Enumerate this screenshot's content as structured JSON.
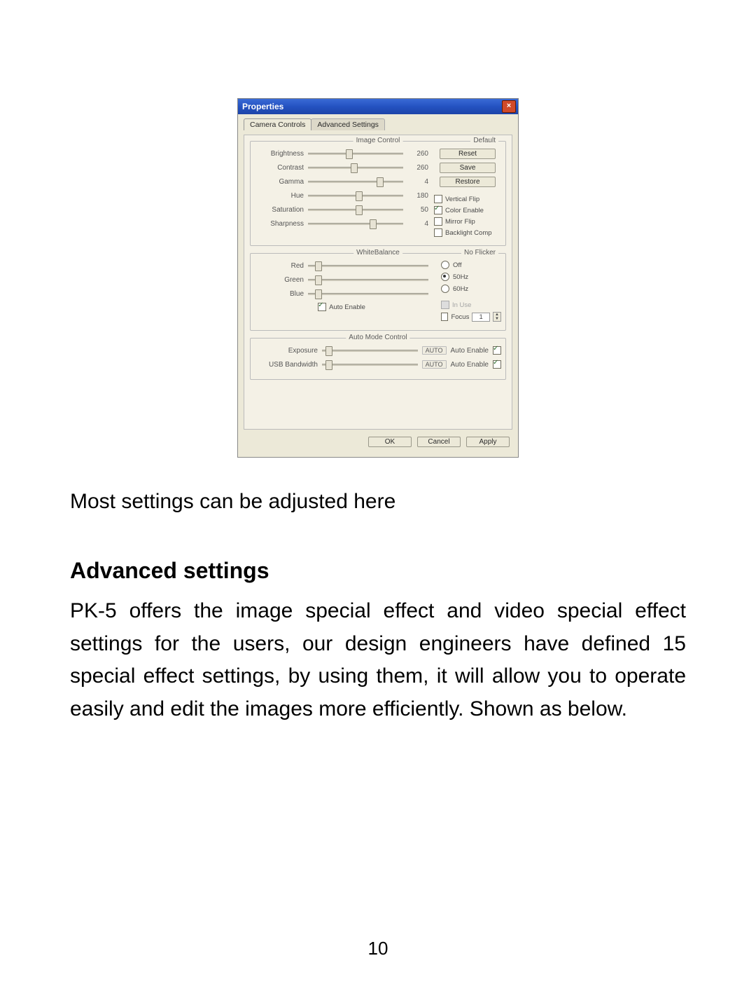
{
  "dialog": {
    "title": "Properties",
    "tabs": {
      "active": "Camera Controls",
      "inactive": "Advanced Settings"
    },
    "image_control": {
      "group_title": "Image Control",
      "sliders": [
        {
          "label": "Brightness",
          "value": "260",
          "pos": 40
        },
        {
          "label": "Contrast",
          "value": "260",
          "pos": 45
        },
        {
          "label": "Gamma",
          "value": "4",
          "pos": 72
        },
        {
          "label": "Hue",
          "value": "180",
          "pos": 50
        },
        {
          "label": "Saturation",
          "value": "50",
          "pos": 50
        },
        {
          "label": "Sharpness",
          "value": "4",
          "pos": 65
        }
      ],
      "default": {
        "group_title": "Default",
        "reset": "Reset",
        "save": "Save",
        "restore": "Restore"
      },
      "checks": {
        "vertical_flip": {
          "label": "Vertical Flip",
          "checked": false
        },
        "color_enable": {
          "label": "Color Enable",
          "checked": true
        },
        "mirror_flip": {
          "label": "Mirror Flip",
          "checked": false
        },
        "backlight": {
          "label": "Backlight Comp",
          "checked": false
        }
      }
    },
    "white_balance": {
      "group_title": "WhiteBalance",
      "sliders": [
        {
          "label": "Red",
          "pos": 6
        },
        {
          "label": "Green",
          "pos": 6
        },
        {
          "label": "Blue",
          "pos": 6
        }
      ],
      "auto_enable": {
        "label": "Auto Enable",
        "checked": true
      },
      "flicker": {
        "group_title": "No Flicker",
        "off": "Off",
        "hz50": "50Hz",
        "hz60": "60Hz",
        "selected": "hz50"
      },
      "focus": {
        "inuse_label": "In Use",
        "focus_label": "Focus",
        "focus_val": "1"
      }
    },
    "auto_mode": {
      "group_title": "Auto Mode Control",
      "rows": [
        {
          "label": "Exposure",
          "badge": "AUTO",
          "auto_label": "Auto Enable",
          "checked": true
        },
        {
          "label": "USB Bandwidth",
          "badge": "AUTO",
          "auto_label": "Auto Enable",
          "checked": true
        }
      ]
    },
    "buttons": {
      "ok": "OK",
      "cancel": "Cancel",
      "apply": "Apply"
    }
  },
  "body": {
    "caption": "Most settings can be adjusted here",
    "heading": "Advanced settings",
    "paragraph": "PK-5 offers the image special effect and video special effect settings for the users, our design engineers have defined 15 special effect settings, by using them, it will allow you to operate easily and edit the images more efficiently. Shown as below.",
    "page_number": "10"
  }
}
